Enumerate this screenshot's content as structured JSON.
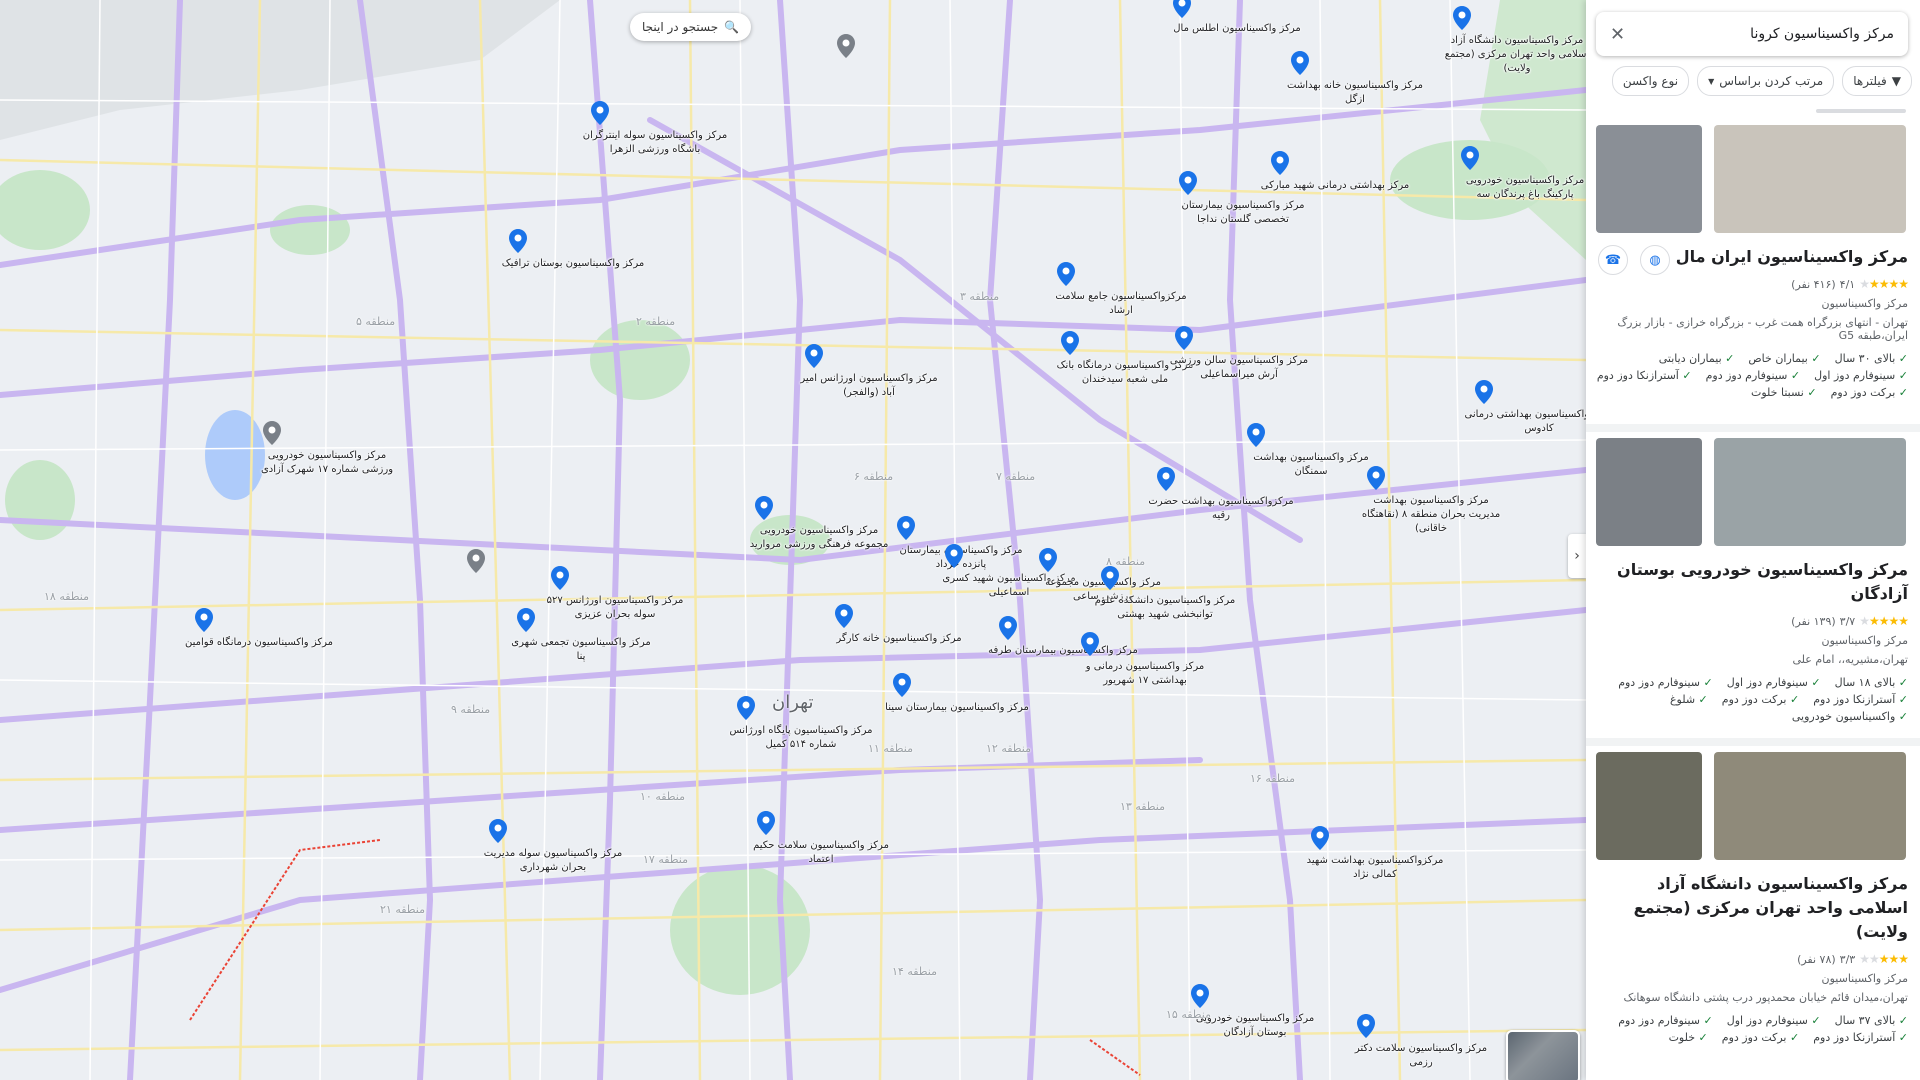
{
  "map": {
    "search_here": "جستجو در اینجا",
    "city": "تهران",
    "areas": [
      "منطقه ۵",
      "منطقه ۲",
      "منطقه ۳",
      "منطقه ۶",
      "منطقه ۷",
      "منطقه ۸",
      "منطقه ۹",
      "منطقه ۱۰",
      "منطقه ۱۱",
      "منطقه ۱۲",
      "منطقه ۱۳",
      "منطقه ۱۴",
      "منطقه ۱۵",
      "منطقه ۱۶",
      "منطقه ۱۷",
      "منطقه ۱۸",
      "منطقه ۲۱"
    ],
    "pins": [
      "مرکز واکسیناسیون اطلس مال",
      "مرکز واکسیناسیون دانشگاه آزاد اسلامی واحد تهران مرکزی (مجتمع ولایت)",
      "مرکز واکسیناسیون خانه بهداشت ازگل",
      "مرکز واکسیناسیون سوله اینترگران باشگاه ورزشی الزهرا",
      "مرکز بهداشتی درمانی شهید مبارکی",
      "مرکز واکسیناسیون خودرویی پارکینگ باغ پرندگان سه",
      "مرکز واکسیناسیون بیمارستان تخصصی گلستان نداجا",
      "مرکز واکسیناسیون بوستان ترافیک",
      "مرکزواکسیناسیون جامع سلامت ارشاد",
      "مرکز واکسیناسیون درمانگاه بانک ملی شعبه سیدخندان",
      "مرکز واکسیناسیون سالن ورزشی آرش میراسماعیلی",
      "مرکز واکسیناسیون اورژانس امیر آباد (والفجر)",
      "مرکز واکسیناسیون بهداشتی درمانی کادوس",
      "مرکز واکسیناسیون بهداشت سمنگان",
      "مرکز واکسیناسیون بهداشت مدیریت بحران منطقه ۸ (نقاهتگاه خاقانی)",
      "مرکزواکسیناسیون بهداشت حضرت رقیه",
      "مرکز واکسیناسیون بیمارستان پانزده خرداد",
      "مرکز واکسیناسیون خودرویی مجموعه فرهنگی ورزشی مروارید",
      "مرکز واکسیناسیون شهید کسری اسماعیلی",
      "مرکز واکسیناسیون مجموعه ورزشی ساعی",
      "مرکز واکسیناسیون دانشکده علوم توانبخشی شهید بهشتی",
      "مرکز واکسیناسیون اورژانس ۵۲۷ سوله بحران عزیزی",
      "مرکز واکسیناسیون تجمعی شهری پنا",
      "مرکز واکسیناسیون درمانگاه قوامین",
      "مرکز واکسیناسیون خانه کارگر",
      "مرکز واکسیناسیون بیمارستان طرفه",
      "مرکز واکسیناسیون درمانی و بهداشتی ۱۷ شهریور",
      "مرکز واکسیناسیون بیمارستان سینا",
      "مرکز واکسیناسیون پایگاه اورژانس شماره ۵۱۴ کمیل",
      "مرکز واکسیناسیون سوله مدیریت بحران شهرداری",
      "مرکز واکسیناسیون سلامت حکیم اعتماد",
      "مرکزواکسیناسیون بهداشت شهید کمالی نژاد",
      "مرکز واکسیناسیون خودرویی بوستان آزادگان",
      "مرکز واکسیناسیون سلامت دکتر رزمی"
    ],
    "gray_pin_label": "مرکز واکسیناسیون خودرویی ورزشی شماره ۱۷ شهرک آزادی"
  },
  "panel": {
    "query": "مرکز واکسیناسیون کرونا",
    "chips": {
      "filters": "فیلترها",
      "sort": "مرتب کردن براساس",
      "vaccine_type": "نوع واکسن"
    },
    "results": [
      {
        "name": "مرکز واکسیناسیون ایران مال",
        "rating": "۴/۱",
        "reviews": "(۴۱۶ نفر)",
        "stars": 4,
        "category": "مرکز واکسیناسیون",
        "address": "تهران - انتهای بزرگراه همت غرب - بزرگراه خرازی - بازار بزرگ ایران،طبقه G5",
        "features": [
          "بالای ۳۰ سال",
          "بیماران خاص",
          "بیماران دیابتی",
          "سینوفارم دوز اول",
          "سینوفارم دوز دوم",
          "آسترازنکا دوز دوم",
          "برکت دوز دوم",
          "نسبتا خلوت"
        ],
        "img_colors": [
          "#8a8f96",
          "#c9c4bb"
        ]
      },
      {
        "name": "مرکز واکسیناسیون خودرویی بوستان آزادگان",
        "rating": "۳/۷",
        "reviews": "(۱۳۹ نفر)",
        "stars": 4,
        "category": "مرکز واکسیناسیون",
        "address": "تهران،مشیریه،، امام علی",
        "features": [
          "بالای ۱۸ سال",
          "سینوفارم دوز اول",
          "سینوفارم دوز دوم",
          "آسترازنکا دوز دوم",
          "برکت دوز دوم",
          "شلوغ",
          "واکسیناسیون خودرویی"
        ],
        "img_colors": [
          "#7b8086",
          "#9aa3a6"
        ]
      },
      {
        "name": "مرکز واکسیناسیون دانشگاه آزاد اسلامی واحد تهران مرکزی (مجتمع ولایت)",
        "rating": "۳/۳",
        "reviews": "(۷۸ نفر)",
        "stars": 3,
        "category": "مرکز واکسیناسیون",
        "address": "تهران،میدان قائم خیابان محمدپور درب پشتی دانشگاه سوهانک",
        "features": [
          "بالای ۳۷ سال",
          "سینوفارم دوز اول",
          "سینوفارم دوز دوم",
          "آسترازنکا دوز دوم",
          "برکت دوز دوم",
          "خلوت"
        ],
        "img_colors": [
          "#6b6b5f",
          "#8f8a7a"
        ]
      }
    ]
  }
}
